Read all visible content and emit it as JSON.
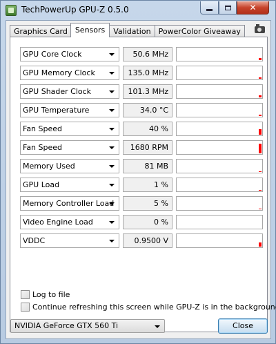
{
  "window": {
    "title": "TechPowerUp GPU-Z 0.5.0",
    "close_glyph": "✕"
  },
  "tabs": [
    {
      "label": "Graphics Card",
      "active": false
    },
    {
      "label": "Sensors",
      "active": true
    },
    {
      "label": "Validation",
      "active": false
    },
    {
      "label": "PowerColor Giveaway",
      "active": false
    }
  ],
  "toolbar": {
    "screenshot_icon": "camera-icon"
  },
  "sensors": [
    {
      "label": "GPU Core Clock",
      "value": "50.6 MHz",
      "graph_level": 0.15
    },
    {
      "label": "GPU Memory Clock",
      "value": "135.0 MHz",
      "graph_level": 0.1
    },
    {
      "label": "GPU Shader Clock",
      "value": "101.3 MHz",
      "graph_level": 0.15
    },
    {
      "label": "GPU Temperature",
      "value": "34.0 °C",
      "graph_level": 0.1
    },
    {
      "label": "Fan Speed",
      "value": "40 %",
      "graph_level": 0.4
    },
    {
      "label": "Fan Speed",
      "value": "1680 RPM",
      "graph_level": 0.75
    },
    {
      "label": "Memory Used",
      "value": "81 MB",
      "graph_level": 0.05
    },
    {
      "label": "GPU Load",
      "value": "1 %",
      "graph_level": 0.05
    },
    {
      "label": "Memory Controller Load",
      "value": "5 %",
      "graph_level": 0.05
    },
    {
      "label": "Video Engine Load",
      "value": "0 %",
      "graph_level": 0.0
    },
    {
      "label": "VDDC",
      "value": "0.9500 V",
      "graph_level": 0.3
    }
  ],
  "graph_color": "#ff0000",
  "options": {
    "log_to_file": {
      "label": "Log to file",
      "checked": false
    },
    "continue_refresh": {
      "label": "Continue refreshing this screen while GPU-Z is in the background",
      "checked": false
    }
  },
  "footer": {
    "gpu_selected": "NVIDIA GeForce GTX 560 Ti",
    "close_label": "Close"
  }
}
